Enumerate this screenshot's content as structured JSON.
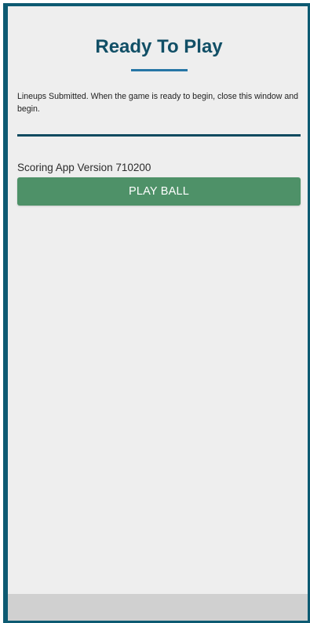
{
  "header": {
    "title": "Ready To Play"
  },
  "message": {
    "text": "Lineups Submitted. When the game is ready to begin, close this window and begin."
  },
  "app": {
    "version_text": "Scoring App Version 710200"
  },
  "actions": {
    "play_ball_label": "PLAY BALL"
  },
  "colors": {
    "accent_border": "#0d5a72",
    "title": "#114f66",
    "underline": "#2676a6",
    "divider": "#0e4a5f",
    "button": "#4e9168",
    "background": "#eeeeee",
    "footer": "#d0d0d0"
  }
}
